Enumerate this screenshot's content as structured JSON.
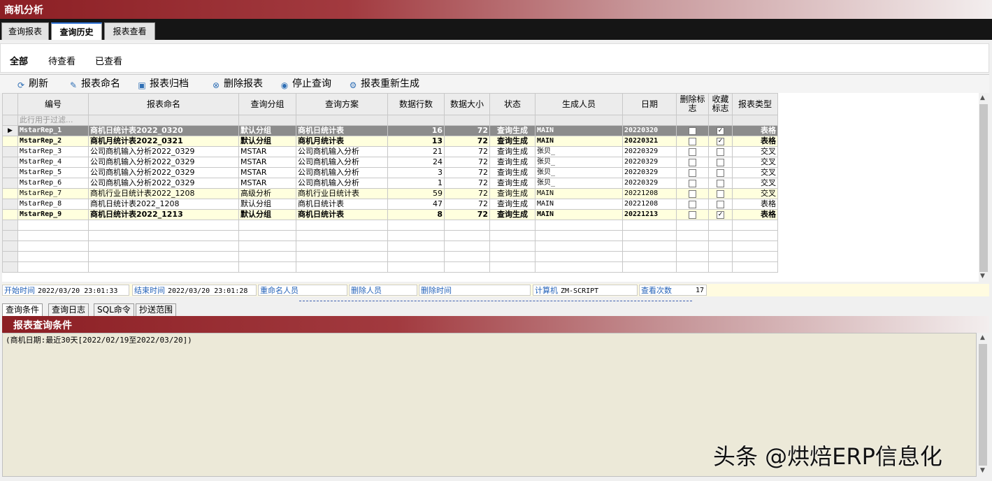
{
  "window": {
    "title": "商机分析"
  },
  "tabs": [
    {
      "label": "查询报表"
    },
    {
      "label": "查询历史"
    },
    {
      "label": "报表查看"
    }
  ],
  "filter_tabs": [
    {
      "label": "全部"
    },
    {
      "label": "待查看"
    },
    {
      "label": "已查看"
    }
  ],
  "toolbar": {
    "refresh": "刷新",
    "rename": "报表命名",
    "archive": "报表归档",
    "delete": "删除报表",
    "stop": "停止查询",
    "regenerate": "报表重新生成"
  },
  "grid": {
    "columns": [
      "编号",
      "报表命名",
      "查询分组",
      "查询方案",
      "数据行数",
      "数据大小",
      "状态",
      "生成人员",
      "日期",
      "删除标志",
      "收藏标志",
      "报表类型"
    ],
    "filter_placeholder": "此行用于过滤...",
    "rows": [
      {
        "id": "MstarRep_1",
        "name": "商机日统计表2022_0320",
        "group": "默认分组",
        "plan": "商机日统计表",
        "rows": "16",
        "size": "72",
        "status": "查询生成",
        "user": "MAIN",
        "date": "20220320",
        "del": false,
        "fav": true,
        "type": "表格"
      },
      {
        "id": "MstarRep_2",
        "name": "商机月统计表2022_0321",
        "group": "默认分组",
        "plan": "商机月统计表",
        "rows": "13",
        "size": "72",
        "status": "查询生成",
        "user": "MAIN",
        "date": "20220321",
        "del": false,
        "fav": true,
        "type": "表格"
      },
      {
        "id": "MstarRep_3",
        "name": "公司商机输入分析2022_0329",
        "group": "MSTAR",
        "plan": "公司商机输入分析",
        "rows": "21",
        "size": "72",
        "status": "查询生成",
        "user": "张贝_",
        "date": "20220329",
        "del": false,
        "fav": false,
        "type": "交叉"
      },
      {
        "id": "MstarRep_4",
        "name": "公司商机输入分析2022_0329",
        "group": "MSTAR",
        "plan": "公司商机输入分析",
        "rows": "24",
        "size": "72",
        "status": "查询生成",
        "user": "张贝_",
        "date": "20220329",
        "del": false,
        "fav": false,
        "type": "交叉"
      },
      {
        "id": "MstarRep_5",
        "name": "公司商机输入分析2022_0329",
        "group": "MSTAR",
        "plan": "公司商机输入分析",
        "rows": "3",
        "size": "72",
        "status": "查询生成",
        "user": "张贝_",
        "date": "20220329",
        "del": false,
        "fav": false,
        "type": "交叉"
      },
      {
        "id": "MstarRep_6",
        "name": "公司商机输入分析2022_0329",
        "group": "MSTAR",
        "plan": "公司商机输入分析",
        "rows": "1",
        "size": "72",
        "status": "查询生成",
        "user": "张贝_",
        "date": "20220329",
        "del": false,
        "fav": false,
        "type": "交叉"
      },
      {
        "id": "MstarRep_7",
        "name": "商机行业日统计表2022_1208",
        "group": "高级分析",
        "plan": "商机行业日统计表",
        "rows": "59",
        "size": "72",
        "status": "查询生成",
        "user": "MAIN",
        "date": "20221208",
        "del": false,
        "fav": false,
        "type": "交叉"
      },
      {
        "id": "MstarRep_8",
        "name": "商机日统计表2022_1208",
        "group": "默认分组",
        "plan": "商机日统计表",
        "rows": "47",
        "size": "72",
        "status": "查询生成",
        "user": "MAIN",
        "date": "20221208",
        "del": false,
        "fav": false,
        "type": "表格"
      },
      {
        "id": "MstarRep_9",
        "name": "商机日统计表2022_1213",
        "group": "默认分组",
        "plan": "商机日统计表",
        "rows": "8",
        "size": "72",
        "status": "查询生成",
        "user": "MAIN",
        "date": "20221213",
        "del": false,
        "fav": true,
        "type": "表格"
      }
    ]
  },
  "status": {
    "start_label": "开始时间",
    "start_value": "2022/03/20 23:01:33",
    "end_label": "结束时间",
    "end_value": "2022/03/20 23:01:28",
    "renamer_label": "重命名人员",
    "deleter_label": "删除人员",
    "delete_time_label": "删除时间",
    "computer_label": "计算机",
    "computer_value": "ZM-SCRIPT",
    "view_count_label": "查看次数",
    "view_count_value": "17"
  },
  "bottom_tabs": [
    {
      "label": "查询条件"
    },
    {
      "label": "查询日志"
    },
    {
      "label": "SQL命令"
    },
    {
      "label": "抄送范围"
    }
  ],
  "panel": {
    "title": "报表查询条件",
    "content": "(商机日期:最近30天[2022/02/19至2022/03/20])"
  },
  "watermark": "头条 @烘焙ERP信息化",
  "colors": {
    "title_red": "#8c1f24",
    "selected_row": "#8c8c8c",
    "highlight_row": "#ffffde",
    "accent_blue": "#2c6fd0"
  }
}
